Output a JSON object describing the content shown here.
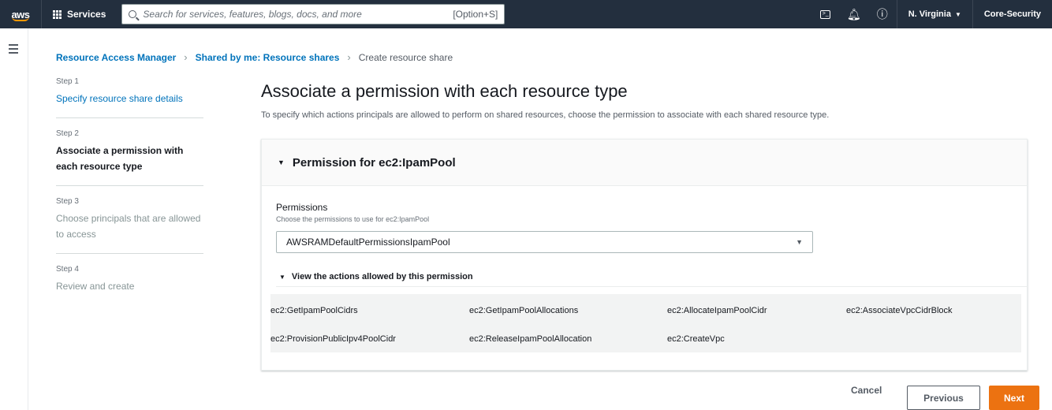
{
  "topbar": {
    "logo": "aws",
    "services_label": "Services",
    "search_placeholder": "Search for services, features, blogs, docs, and more",
    "search_shortcut": "[Option+S]",
    "region": "N. Virginia",
    "account": "Core-Security",
    "icons": [
      "cloudshell-icon",
      "bell-icon",
      "help-icon"
    ]
  },
  "breadcrumb": {
    "items": [
      "Resource Access Manager",
      "Shared by me: Resource shares"
    ],
    "current": "Create resource share"
  },
  "steps": [
    {
      "num": "Step 1",
      "title": "Specify resource share details",
      "state": "link"
    },
    {
      "num": "Step 2",
      "title": "Associate a permission with each resource type",
      "state": "active"
    },
    {
      "num": "Step 3",
      "title": "Choose principals that are allowed to access",
      "state": "disabled"
    },
    {
      "num": "Step 4",
      "title": "Review and create",
      "state": "disabled"
    }
  ],
  "main": {
    "title": "Associate a permission with each resource type",
    "description": "To specify which actions principals are allowed to perform on shared resources, choose the permission to associate with each shared resource type."
  },
  "panel": {
    "header": "Permission for ec2:IpamPool",
    "field_label": "Permissions",
    "field_description": "Choose the permissions to use for ec2:IpamPool",
    "selected_permission": "AWSRAMDefaultPermissionsIpamPool",
    "expander_label": "View the actions allowed by this permission",
    "actions": [
      "ec2:GetIpamPoolCidrs",
      "ec2:GetIpamPoolAllocations",
      "ec2:AllocateIpamPoolCidr",
      "ec2:AssociateVpcCidrBlock",
      "ec2:ProvisionPublicIpv4PoolCidr",
      "ec2:ReleaseIpamPoolAllocation",
      "ec2:CreateVpc"
    ]
  },
  "footer": {
    "cancel": "Cancel",
    "previous": "Previous",
    "next": "Next"
  },
  "colors": {
    "nav_bg": "#232f3e",
    "link": "#0073bb",
    "primary_button": "#ec7211"
  }
}
